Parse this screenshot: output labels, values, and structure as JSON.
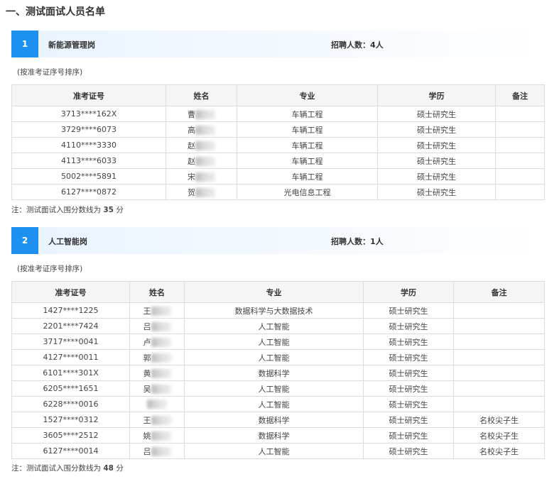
{
  "page_title": "一、测试面试人员名单",
  "headers": [
    "准考证号",
    "姓名",
    "专业",
    "学历",
    "备注"
  ],
  "sort_note": "(按准考证序号排序)",
  "note_prefix": "注：测试面试入围分数线为",
  "note_suffix": "分",
  "sections": [
    {
      "num": "1",
      "name": "新能源管理岗",
      "recruit": "招聘人数：4人",
      "cutoff": "35",
      "rows": [
        {
          "id": "3713****162X",
          "name": "曹",
          "major": "车辆工程",
          "edu": "硕士研究生",
          "remark": ""
        },
        {
          "id": "3729****6073",
          "name": "高",
          "major": "车辆工程",
          "edu": "硕士研究生",
          "remark": ""
        },
        {
          "id": "4110****3330",
          "name": "赵",
          "major": "车辆工程",
          "edu": "硕士研究生",
          "remark": ""
        },
        {
          "id": "4113****6033",
          "name": "赵",
          "major": "车辆工程",
          "edu": "硕士研究生",
          "remark": ""
        },
        {
          "id": "5002****5891",
          "name": "宋",
          "major": "车辆工程",
          "edu": "硕士研究生",
          "remark": ""
        },
        {
          "id": "6127****0872",
          "name": "贺",
          "major": "光电信息工程",
          "edu": "硕士研究生",
          "remark": ""
        }
      ]
    },
    {
      "num": "2",
      "name": "人工智能岗",
      "recruit": "招聘人数：1人",
      "cutoff": "48",
      "rows": [
        {
          "id": "1427****1225",
          "name": "王",
          "major": "数据科学与大数据技术",
          "edu": "硕士研究生",
          "remark": ""
        },
        {
          "id": "2201****7424",
          "name": "吕",
          "major": "人工智能",
          "edu": "硕士研究生",
          "remark": ""
        },
        {
          "id": "3717****0041",
          "name": "卢",
          "major": "人工智能",
          "edu": "硕士研究生",
          "remark": ""
        },
        {
          "id": "4127****0011",
          "name": "郭",
          "major": "人工智能",
          "edu": "硕士研究生",
          "remark": ""
        },
        {
          "id": "6101****301X",
          "name": "黄",
          "major": "数据科学",
          "edu": "硕士研究生",
          "remark": ""
        },
        {
          "id": "6205****1651",
          "name": "吴",
          "major": "人工智能",
          "edu": "硕士研究生",
          "remark": ""
        },
        {
          "id": "6228****0016",
          "name": "",
          "major": "人工智能",
          "edu": "硕士研究生",
          "remark": ""
        },
        {
          "id": "1527****0312",
          "name": "王",
          "major": "数据科学",
          "edu": "硕士研究生",
          "remark": "名校尖子生"
        },
        {
          "id": "3605****2512",
          "name": "姚",
          "major": "数据科学",
          "edu": "硕士研究生",
          "remark": "名校尖子生"
        },
        {
          "id": "6127****0014",
          "name": "吕",
          "major": "人工智能",
          "edu": "硕士研究生",
          "remark": "名校尖子生"
        }
      ]
    }
  ]
}
